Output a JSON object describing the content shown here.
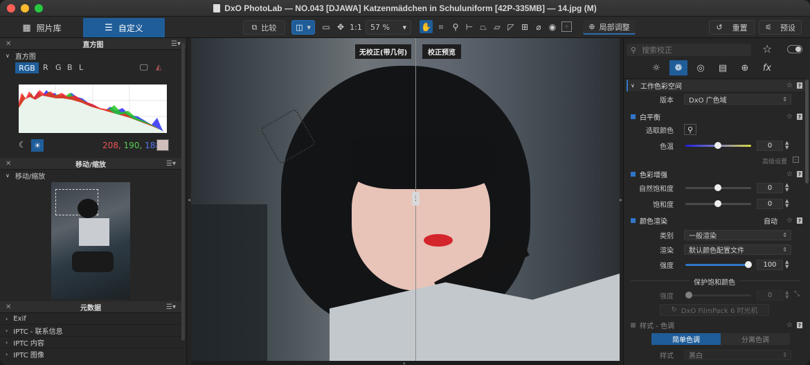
{
  "window": {
    "title": "DxO PhotoLab — NO.043 [DJAWA] Katzenmädchen in Schuluniform [42P-335MB] — 14.jpg (M)"
  },
  "tabs": [
    {
      "label": "照片库"
    },
    {
      "label": "自定义"
    }
  ],
  "toolbar": {
    "compare_label": "比较",
    "one_to_one": "1:1",
    "zoom": "57 %",
    "local_adjust_label": "局部调整",
    "reset_label": "重置",
    "preset_label": "预设"
  },
  "left_panel": {
    "histogram": {
      "title": "直方图",
      "subtitle": "直方图",
      "channels": [
        "RGB",
        "R",
        "G",
        "B",
        "L"
      ],
      "rgb_r": "208,",
      "rgb_g": "190,",
      "rgb_b": "188",
      "swatch_color": "#d0bebc"
    },
    "move_zoom": {
      "title": "移动/缩放",
      "subtitle": "移动/缩放"
    },
    "metadata": {
      "title": "元数据",
      "items": [
        "Exif",
        "IPTC - 联系信息",
        "IPTC 内容",
        "IPTC 图像"
      ]
    }
  },
  "viewer": {
    "label_left": "无校正(带几何)",
    "label_right": "校正预览"
  },
  "right_panel": {
    "search_placeholder": "搜索校正",
    "sections": {
      "working_space": {
        "title": "工作色彩空间",
        "version_label": "版本",
        "version_value": "DxO 广色域"
      },
      "white_balance": {
        "title": "白平衡",
        "pick_label": "选取颜色",
        "temp_label": "色温",
        "temp_value": "0",
        "advanced": "高级设置"
      },
      "color_accent": {
        "title": "色彩增强",
        "vibrancy_label": "自然饱和度",
        "vibrancy_value": "0",
        "saturation_label": "饱和度",
        "saturation_value": "0"
      },
      "color_rendering": {
        "title": "颜色渲染",
        "auto": "自动",
        "category_label": "类别",
        "category_value": "一般渲染",
        "rendering_label": "渲染",
        "rendering_value": "默认颜色配置文件",
        "intensity_label": "强度",
        "intensity_value": "100",
        "protect_label": "保护饱和颜色",
        "protect_intensity_label": "强度",
        "protect_intensity_value": "0",
        "filmpack_label": "DxO FilmPack 6 时光机"
      },
      "style_toning": {
        "title": "样式 - 色调",
        "tab_simple": "简单色调",
        "tab_split": "分离色调",
        "style_label": "样式",
        "style_value": "黑白"
      }
    }
  }
}
